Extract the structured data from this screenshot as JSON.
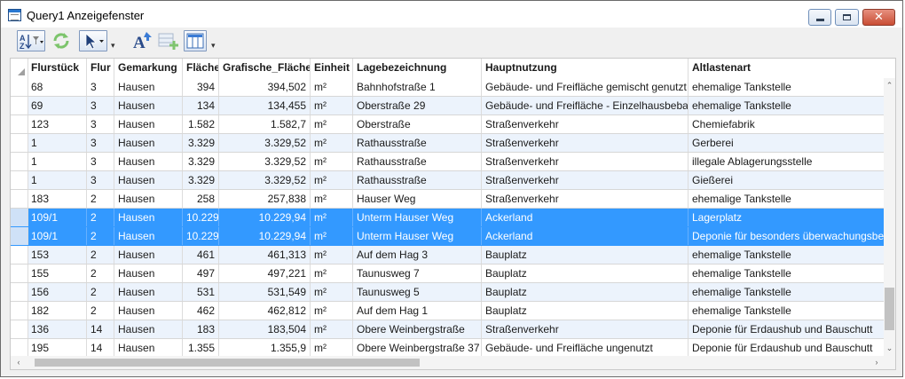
{
  "window": {
    "title": "Query1 Anzeigefenster"
  },
  "toolbar": {
    "buttons": [
      {
        "name": "sort-filter",
        "icon": "sort-az-icon"
      },
      {
        "name": "refresh",
        "icon": "refresh-icon"
      },
      {
        "name": "select-tool",
        "icon": "cursor-arrow-icon"
      },
      {
        "name": "label-text",
        "icon": "text-label-icon"
      },
      {
        "name": "add-row",
        "icon": "add-table-icon"
      },
      {
        "name": "column-view",
        "icon": "columns-icon"
      }
    ]
  },
  "columns": [
    "Flurstück",
    "Flur",
    "Gemarkung",
    "Fläche",
    "Grafische_Fläche",
    "Einheit",
    "Lagebezeichnung",
    "Hauptnutzung",
    "Altlastenart"
  ],
  "rows": [
    {
      "flurstueck": "68",
      "flur": "3",
      "gemarkung": "Hausen",
      "flaeche": "394",
      "grafische_flaeche": "394,502",
      "einheit": "m²",
      "lage": "Bahnhofstraße 1",
      "hauptnutzung": "Gebäude- und Freifläche gemischt genutzt",
      "altlastenart": "ehemalige Tankstelle",
      "selected": false
    },
    {
      "flurstueck": "69",
      "flur": "3",
      "gemarkung": "Hausen",
      "flaeche": "134",
      "grafische_flaeche": "134,455",
      "einheit": "m²",
      "lage": "Oberstraße 29",
      "hauptnutzung": "Gebäude- und Freifläche - Einzelhausbebauung",
      "altlastenart": "ehemalige Tankstelle",
      "selected": false
    },
    {
      "flurstueck": "123",
      "flur": "3",
      "gemarkung": "Hausen",
      "flaeche": "1.582",
      "grafische_flaeche": "1.582,7",
      "einheit": "m²",
      "lage": "Oberstraße",
      "hauptnutzung": "Straßenverkehr",
      "altlastenart": "Chemiefabrik",
      "selected": false
    },
    {
      "flurstueck": "1",
      "flur": "3",
      "gemarkung": "Hausen",
      "flaeche": "3.329",
      "grafische_flaeche": "3.329,52",
      "einheit": "m²",
      "lage": "Rathausstraße",
      "hauptnutzung": "Straßenverkehr",
      "altlastenart": "Gerberei",
      "selected": false
    },
    {
      "flurstueck": "1",
      "flur": "3",
      "gemarkung": "Hausen",
      "flaeche": "3.329",
      "grafische_flaeche": "3.329,52",
      "einheit": "m²",
      "lage": "Rathausstraße",
      "hauptnutzung": "Straßenverkehr",
      "altlastenart": "illegale Ablagerungsstelle",
      "selected": false
    },
    {
      "flurstueck": "1",
      "flur": "3",
      "gemarkung": "Hausen",
      "flaeche": "3.329",
      "grafische_flaeche": "3.329,52",
      "einheit": "m²",
      "lage": "Rathausstraße",
      "hauptnutzung": "Straßenverkehr",
      "altlastenart": "Gießerei",
      "selected": false
    },
    {
      "flurstueck": "183",
      "flur": "2",
      "gemarkung": "Hausen",
      "flaeche": "258",
      "grafische_flaeche": "257,838",
      "einheit": "m²",
      "lage": "Hauser Weg",
      "hauptnutzung": "Straßenverkehr",
      "altlastenart": "ehemalige Tankstelle",
      "selected": false
    },
    {
      "flurstueck": "109/1",
      "flur": "2",
      "gemarkung": "Hausen",
      "flaeche": "10.229",
      "grafische_flaeche": "10.229,94",
      "einheit": "m²",
      "lage": "Unterm Hauser Weg",
      "hauptnutzung": "Ackerland",
      "altlastenart": "Lagerplatz",
      "selected": true
    },
    {
      "flurstueck": "109/1",
      "flur": "2",
      "gemarkung": "Hausen",
      "flaeche": "10.229",
      "grafische_flaeche": "10.229,94",
      "einheit": "m²",
      "lage": "Unterm Hauser Weg",
      "hauptnutzung": "Ackerland",
      "altlastenart": "Deponie für besonders überwachungsbedürftige Abfälle",
      "selected": true
    },
    {
      "flurstueck": "153",
      "flur": "2",
      "gemarkung": "Hausen",
      "flaeche": "461",
      "grafische_flaeche": "461,313",
      "einheit": "m²",
      "lage": "Auf dem Hag 3",
      "hauptnutzung": "Bauplatz",
      "altlastenart": "ehemalige Tankstelle",
      "selected": false
    },
    {
      "flurstueck": "155",
      "flur": "2",
      "gemarkung": "Hausen",
      "flaeche": "497",
      "grafische_flaeche": "497,221",
      "einheit": "m²",
      "lage": "Taunusweg 7",
      "hauptnutzung": "Bauplatz",
      "altlastenart": "ehemalige Tankstelle",
      "selected": false
    },
    {
      "flurstueck": "156",
      "flur": "2",
      "gemarkung": "Hausen",
      "flaeche": "531",
      "grafische_flaeche": "531,549",
      "einheit": "m²",
      "lage": "Taunusweg 5",
      "hauptnutzung": "Bauplatz",
      "altlastenart": "ehemalige Tankstelle",
      "selected": false
    },
    {
      "flurstueck": "182",
      "flur": "2",
      "gemarkung": "Hausen",
      "flaeche": "462",
      "grafische_flaeche": "462,812",
      "einheit": "m²",
      "lage": "Auf dem Hag 1",
      "hauptnutzung": "Bauplatz",
      "altlastenart": "ehemalige Tankstelle",
      "selected": false
    },
    {
      "flurstueck": "136",
      "flur": "14",
      "gemarkung": "Hausen",
      "flaeche": "183",
      "grafische_flaeche": "183,504",
      "einheit": "m²",
      "lage": "Obere Weinbergstraße",
      "hauptnutzung": "Straßenverkehr",
      "altlastenart": "Deponie für Erdaushub und Bauschutt",
      "selected": false
    },
    {
      "flurstueck": "195",
      "flur": "14",
      "gemarkung": "Hausen",
      "flaeche": "1.355",
      "grafische_flaeche": "1.355,9",
      "einheit": "m²",
      "lage": "Obere Weinbergstraße 37",
      "hauptnutzung": "Gebäude- und Freifläche ungenutzt",
      "altlastenart": "Deponie für Erdaushub und Bauschutt",
      "selected": false
    }
  ],
  "colors": {
    "selection": "#3399ff",
    "alt_row": "#ecf3fc"
  }
}
